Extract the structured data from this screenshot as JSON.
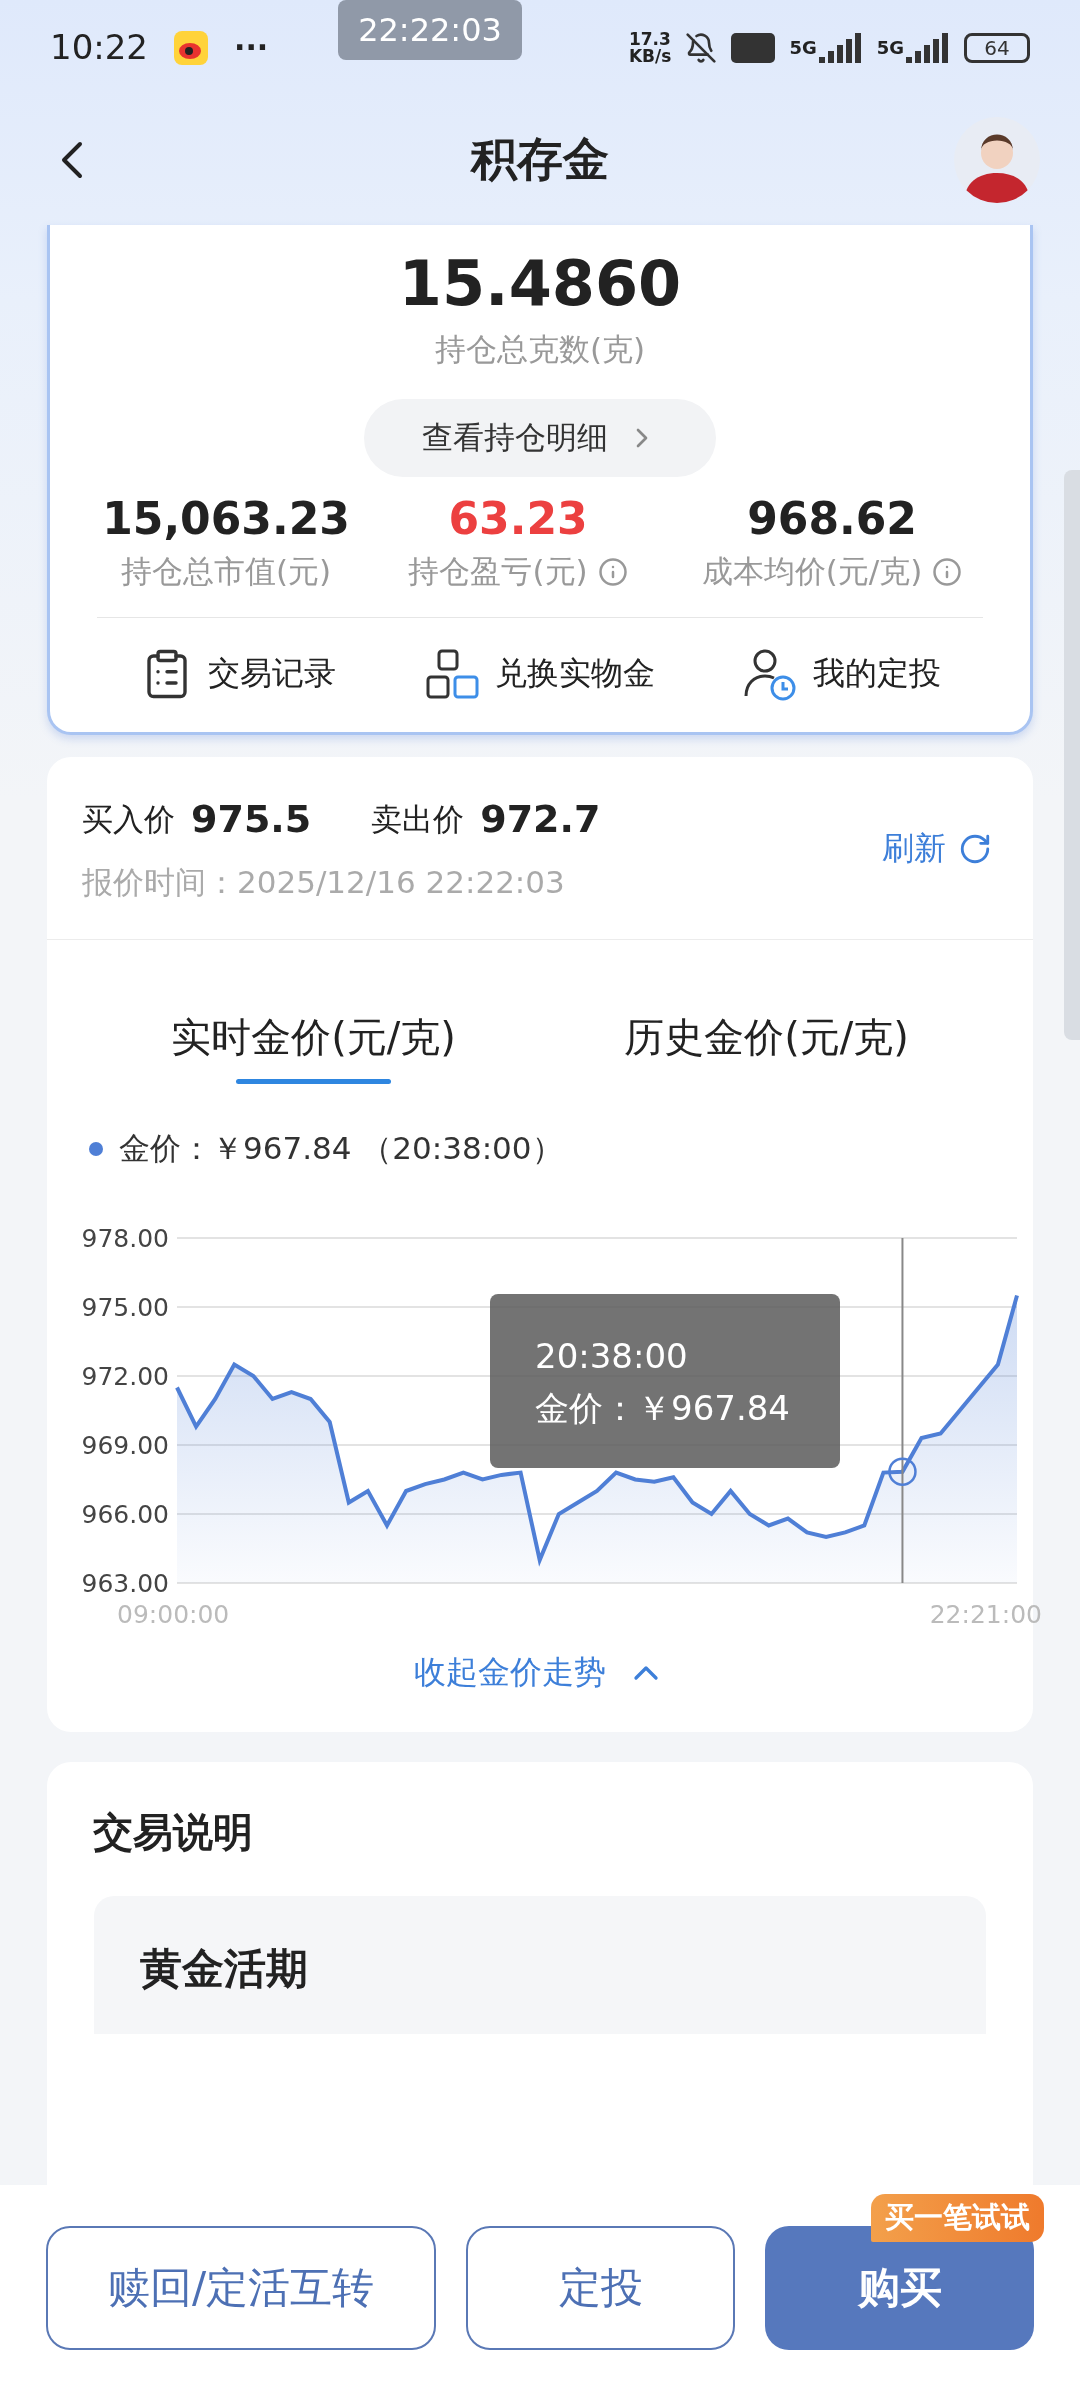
{
  "status_bar": {
    "time": "10:22",
    "more": "···",
    "speed": "17.3\nKB/s",
    "networks": [
      "5G",
      "5G"
    ],
    "battery": "64"
  },
  "timer_overlay": "22:22:03",
  "nav": {
    "title": "积存金"
  },
  "holding": {
    "grams": "15.4860",
    "grams_label": "持仓总克数(克)",
    "detail_button": "查看持仓明细",
    "stats": [
      {
        "value": "15,063.23",
        "label": "持仓总市值(元)",
        "kind": "plain",
        "info": false
      },
      {
        "value": "63.23",
        "label": "持仓盈亏(元)",
        "kind": "gain",
        "info": true
      },
      {
        "value": "968.62",
        "label": "成本均价(元/克)",
        "kind": "plain",
        "info": true
      }
    ],
    "actions": [
      {
        "label": "交易记录",
        "kind": "records"
      },
      {
        "label": "兑换实物金",
        "kind": "exchange"
      },
      {
        "label": "我的定投",
        "kind": "plan"
      }
    ]
  },
  "quote": {
    "buy_label": "买入价",
    "buy": "975.5",
    "sell_label": "卖出价",
    "sell": "972.7",
    "time": "报价时间：2025/12/16 22:22:03",
    "refresh": "刷新"
  },
  "tabs": [
    {
      "label": "实时金价(元/克)",
      "selected": true
    },
    {
      "label": "历史金价(元/克)",
      "selected": false
    }
  ],
  "legend": "：￥967.84 （20:38:00）",
  "time_axis": {
    "start": "09:00:00",
    "end": "22:21:00"
  },
  "tooltip": {
    "time": "20:38:00",
    "label": "金价：￥967.84"
  },
  "chart_data": {
    "type": "area",
    "ylim": [
      963,
      978
    ],
    "yticks": [
      {
        "value": 963,
        "label": "963.00"
      },
      {
        "value": 966,
        "label": "966.00"
      },
      {
        "value": 969,
        "label": "969.00"
      },
      {
        "value": 972,
        "label": "972.00"
      },
      {
        "value": 975,
        "label": "975.00"
      },
      {
        "value": 978,
        "label": "978.00"
      }
    ],
    "grid": true,
    "series": [
      {
        "name": "金价",
        "color": "#4f7fd6",
        "values": [
          971.5,
          969.8,
          971,
          972.5,
          972,
          971,
          971.3,
          971,
          970,
          966.5,
          967,
          965.5,
          967,
          967.3,
          967.5,
          967.8,
          967.5,
          967.7,
          967.8,
          964,
          966,
          966.5,
          967,
          967.8,
          967.5,
          967.4,
          967.6,
          966.5,
          966,
          967,
          966,
          965.5,
          965.8,
          965.2,
          965,
          965.2,
          965.5,
          967.8,
          967.84,
          969.3,
          969.5,
          970.5,
          971.5,
          972.5,
          975.5
        ]
      }
    ]
  },
  "collapse": "收起金价走势",
  "info": {
    "title": "交易说明",
    "section": "黄金活期"
  },
  "buttons": [
    {
      "label": "赎回/定活互转",
      "kind": "outline"
    },
    {
      "label": "定投",
      "kind": "outline"
    },
    {
      "label": "购买",
      "kind": "primary",
      "badge": "买一笔试试"
    }
  ]
}
